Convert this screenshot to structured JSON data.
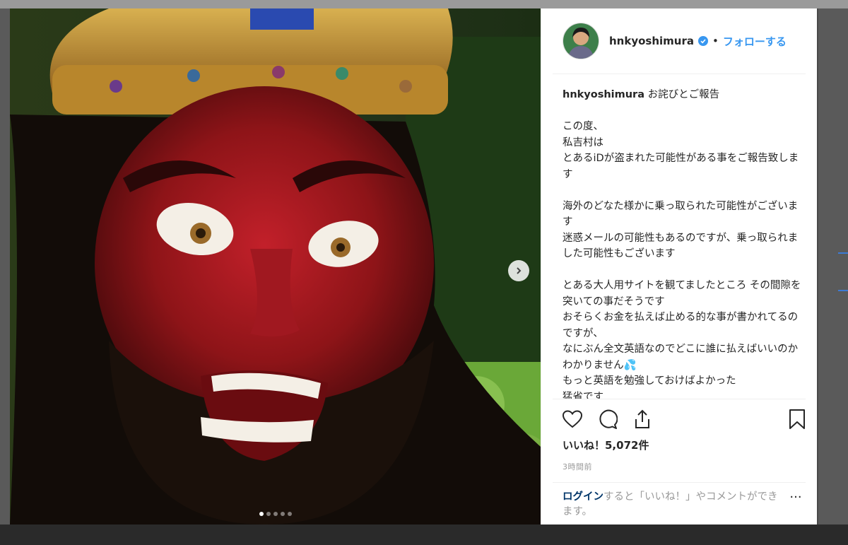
{
  "post": {
    "username": "hnkyoshimura",
    "separator": "•",
    "follow_label": "フォローする",
    "caption_user": "hnkyoshimura",
    "caption_text": " お詫びとご報告\n\nこの度、\n私吉村は\nとあるiDが盗まれた可能性がある事をご報告致します\n\n海外のどなた様かに乗っ取られた可能性がございます\n迷惑メールの可能性もあるのですが、乗っ取られました可能性もございます\n\nとある大人用サイトを観てましたところ その間隙を突いての事だそうです\nおそらくお金を払えば止める的な事が書かれてるのですが、\nなにぶん全文英語なのでどこに誰に払えばいいのかわかりません💦\nもっと英語を勉強しておけばよかった\n猛省です",
    "likes": "いいね！5,072件",
    "time": "3時間前",
    "login_link": "ログイン",
    "login_rest": "すると「いいね！」やコメントができます。",
    "more_label": "···"
  },
  "carousel": {
    "total": 5,
    "active_index": 0
  },
  "colors": {
    "link": "#3897f0",
    "verified": "#3897f0",
    "text": "#262626",
    "muted": "#999999"
  },
  "icons": [
    "verified-icon",
    "chevron-right-icon",
    "heart-icon",
    "comment-icon",
    "share-icon",
    "bookmark-icon",
    "more-icon"
  ]
}
